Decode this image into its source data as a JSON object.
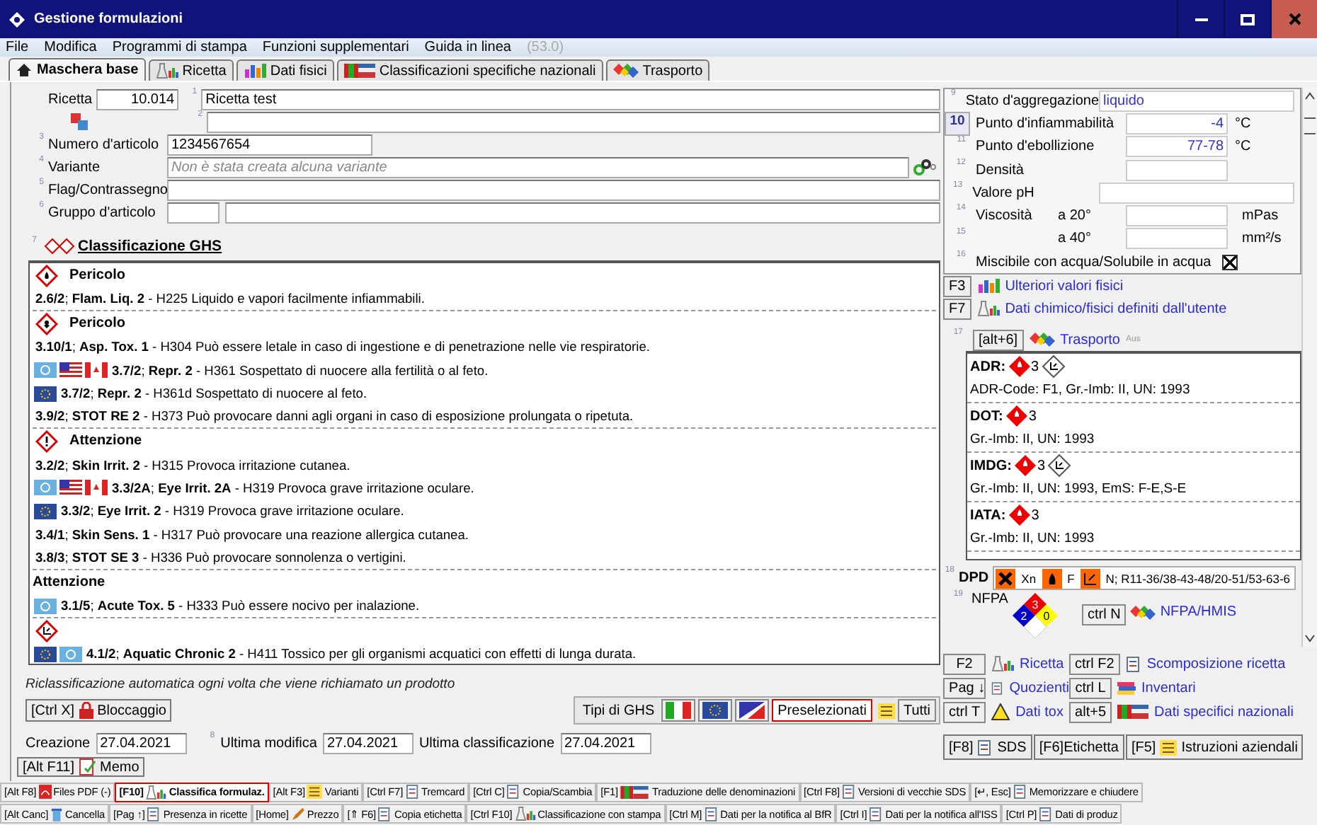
{
  "window": {
    "title": "Gestione formulazioni"
  },
  "menu": {
    "items": [
      "File",
      "Modifica",
      "Programmi di stampa",
      "Funzioni supplementari",
      "Guida in linea"
    ],
    "version": "(53.0)"
  },
  "tabs": [
    {
      "label": "Maschera base",
      "selected": true
    },
    {
      "label": "Ricetta",
      "selected": false
    },
    {
      "label": "Dati fisici",
      "selected": false
    },
    {
      "label": "Classificazioni specifiche nazionali",
      "selected": false
    },
    {
      "label": "Trasporto",
      "selected": false
    }
  ],
  "recipe": {
    "label": "Ricetta",
    "number": "10.014",
    "fields": [
      {
        "index": "1",
        "value": "Ricetta test"
      },
      {
        "index": "2"
      }
    ]
  },
  "form_fields": [
    {
      "index": "3",
      "label": "Numero d'articolo",
      "value": "1234567654",
      "kind": "short"
    },
    {
      "index": "4",
      "label": "Variante",
      "placeholder": "Non è stata creata alcuna variante",
      "kind": "variant"
    },
    {
      "index": "5",
      "label": "Flag/Contrassegno",
      "kind": "wide"
    },
    {
      "index": "6",
      "label": "Gruppo d'articolo",
      "kind": "group"
    }
  ],
  "ghs": {
    "index": "7",
    "title": "Classificazione GHS",
    "groups": [
      {
        "pictogram": {
          "kind": "flame"
        },
        "signal_word": "Pericolo",
        "entries": [
          {
            "text": "**2.6/2**; **Flam. Liq. 2** - H225 Liquido e vapori facilmente infiammabili."
          }
        ]
      },
      {
        "pictogram": {
          "kind": "health"
        },
        "signal_word": "Pericolo",
        "entries": [
          {
            "text": "**3.10/1**; **Asp. Tox. 1** - H304 Può essere letale in caso di ingestione e di penetrazione nelle vie respiratorie."
          },
          {
            "flags": [
              {
                "kind": "un"
              },
              {
                "kind": "us"
              },
              {
                "kind": "ca"
              }
            ],
            "text": "**3.7/2**; **Repr. 2** - H361 Sospettato di nuocere alla fertilità o al feto."
          },
          {
            "flags": [
              {
                "kind": "eu"
              }
            ],
            "text": "**3.7/2**; **Repr. 2** - H361d Sospettato di nuocere al feto."
          },
          {
            "text": "**3.9/2**; **STOT RE 2** - H373 Può provocare danni agli organi in caso di esposizione prolungata o ripetuta."
          }
        ]
      },
      {
        "pictogram": {
          "kind": "exclamation"
        },
        "signal_word": "Attenzione",
        "entries": [
          {
            "text": "**3.2/2**; **Skin Irrit. 2** - H315 Provoca irritazione cutanea."
          },
          {
            "flags": [
              {
                "kind": "un"
              },
              {
                "kind": "us"
              },
              {
                "kind": "ca"
              }
            ],
            "text": "**3.3/2A**; **Eye Irrit. 2A** - H319 Provoca grave irritazione oculare."
          },
          {
            "flags": [
              {
                "kind": "eu"
              }
            ],
            "text": "**3.3/2**; **Eye Irrit. 2** - H319 Provoca grave irritazione oculare."
          },
          {
            "text": "**3.4/1**; **Skin Sens. 1** - H317 Può provocare una reazione allergica cutanea."
          },
          {
            "text": "**3.8/3**; **STOT SE 3** - H336 Può provocare sonnolenza o vertigini."
          }
        ]
      },
      {
        "signal_word": "Attenzione",
        "entries": [
          {
            "flags": [
              {
                "kind": "un"
              }
            ],
            "text": "**3.1/5**; **Acute Tox. 5** - H333 Può essere nocivo per inalazione."
          }
        ]
      },
      {
        "pictogram": {
          "kind": "environment"
        },
        "entries": [
          {
            "flags": [
              {
                "kind": "eu"
              },
              {
                "kind": "un"
              }
            ],
            "text": "**4.1/2**; **Aquatic Chronic 2** - H411 Tossico per gli organismi acquatici con effetti di lunga durata."
          }
        ]
      }
    ]
  },
  "note": "Riclassificazione automatica ogni volta che viene richiamato un prodotto",
  "lock_button": {
    "key": "[Ctrl X]",
    "label": "Bloccaggio"
  },
  "ghs_types": {
    "label": "Tipi di GHS",
    "options": [
      {
        "kind": "flag-it",
        "selected": false
      },
      {
        "kind": "flag-eu",
        "selected": false
      },
      {
        "kind": "flag-us-ca",
        "selected": false
      },
      {
        "kind": "text",
        "text": "Preselezionati",
        "selected": true
      },
      {
        "kind": "list",
        "text": "Tutti",
        "selected": false
      }
    ]
  },
  "dates": [
    {
      "label": "Creazione",
      "value": "27.04.2021"
    },
    {
      "index": "8",
      "label": "Ultima modifica",
      "value": "27.04.2021"
    },
    {
      "label": "Ultima classificazione",
      "value": "27.04.2021"
    }
  ],
  "memo_button": {
    "key": "[Alt F11]",
    "label": "Memo"
  },
  "properties": [
    {
      "index": "9",
      "label": "Stato d'aggregazione",
      "value": "liquido",
      "kind": "wide",
      "highlighted": false
    },
    {
      "index": "10",
      "label": "Punto d'infiammabilità",
      "value": "-4",
      "unit": "°C",
      "kind": "numeric",
      "highlighted": true
    },
    {
      "index": "11",
      "label": "Punto d'ebollizione",
      "value": "77-78",
      "unit": "°C",
      "kind": "numeric",
      "highlighted": false
    },
    {
      "index": "12",
      "label": "Densità",
      "kind": "numeric",
      "highlighted": false
    },
    {
      "index": "13",
      "label": "Valore pH",
      "kind": "wide",
      "highlighted": false
    },
    {
      "index": "14",
      "label": "Viscosità",
      "sublabel": "a 20°",
      "unit": "mPas",
      "kind": "viscosity",
      "highlighted": false
    },
    {
      "index": "15",
      "sublabel": "a 40°",
      "unit": "mm²/s",
      "kind": "viscosity",
      "highlighted": false
    },
    {
      "index": "16",
      "label": "Miscibile con acqua/Solubile in acqua",
      "kind": "checkbox",
      "checked": true,
      "highlighted": false
    }
  ],
  "physical_links": [
    {
      "key": "F3",
      "label": "Ulteriori valori fisici"
    },
    {
      "key": "F7",
      "label": "Dati chimico/fisici definiti dall'utente"
    }
  ],
  "transport": {
    "index": "17",
    "key": "[alt+6]",
    "label": "Trasporto",
    "note": "Aus",
    "items": [
      {
        "mode": "ADR:",
        "class": "3",
        "environment": true,
        "details": "ADR-Code: F1, Gr.-Imb: II, UN: 1993"
      },
      {
        "mode": "DOT:",
        "class": "3",
        "environment": false,
        "details": "Gr.-Imb: II, UN: 1993"
      },
      {
        "mode": "IMDG:",
        "class": "3",
        "environment": true,
        "details": "Gr.-Imb: II, UN: 1993, EmS: F-E,S-E"
      },
      {
        "mode": "IATA:",
        "class": "3",
        "environment": false,
        "details": "Gr.-Imb: II, UN: 1993"
      }
    ]
  },
  "dpd": {
    "index": "18",
    "label": "DPD",
    "symbols": [
      {
        "kind": "cross",
        "text": "Xn"
      },
      {
        "kind": "flame",
        "text": "F"
      },
      {
        "kind": "environment",
        "text": "N; R11-36/38-43-48/20-51/53-63-6"
      }
    ]
  },
  "nfpa": {
    "index": "19",
    "label": "NFPA",
    "flammability": "3",
    "health": "2",
    "instability": "0",
    "key": "ctrl N",
    "link": "NFPA/HMIS"
  },
  "links": [
    {
      "key": "F2",
      "label": "Ricetta"
    },
    {
      "key": "ctrl F2",
      "label": "Scomposizione ricetta"
    },
    {
      "key": "Pag ↓",
      "label": "Quozienti"
    },
    {
      "key": "ctrl L",
      "label": "Inventari"
    },
    {
      "key": "ctrl T",
      "label": "Dati tox"
    },
    {
      "key": "alt+5",
      "label": "Dati specifici nazionali"
    }
  ],
  "doc_buttons": [
    {
      "key": "[F8]",
      "label": "SDS"
    },
    {
      "key": "[F6]",
      "label": "Etichetta"
    },
    {
      "key": "[F5]",
      "label": "Istruzioni aziendali"
    }
  ],
  "toolbars": [
    [
      {
        "key": "[Alt F8]",
        "label": "Files PDF (-)",
        "selected": false
      },
      {
        "key": "[F10]",
        "label": "Classifica formulaz.",
        "selected": true
      },
      {
        "key": "[Alt F3]",
        "label": "Varianti",
        "selected": false
      },
      {
        "key": "[Ctrl F7]",
        "label": "Tremcard",
        "selected": false
      },
      {
        "key": "[Ctrl C]",
        "label": "Copia/Scambia",
        "selected": false
      },
      {
        "key": "[F1]",
        "label": "Traduzione delle denominazioni",
        "selected": false
      },
      {
        "key": "[Ctrl F8]",
        "label": "Versioni di vecchie SDS",
        "selected": false
      },
      {
        "key": "[↵, Esc]",
        "label": "Memorizzare e chiudere",
        "selected": false
      }
    ],
    [
      {
        "key": "[Alt Canc]",
        "label": "Cancella",
        "selected": false
      },
      {
        "key": "[Pag ↑]",
        "label": "Presenza in ricette",
        "selected": false
      },
      {
        "key": "[Home]",
        "label": "Prezzo",
        "selected": false
      },
      {
        "key": "[⇑ F6]",
        "label": "Copia etichetta",
        "selected": false
      },
      {
        "key": "[Ctrl F10]",
        "label": "Classificazione con stampa",
        "selected": false
      },
      {
        "key": "[Ctrl M]",
        "label": "Dati per la notifica al BfR",
        "selected": false
      },
      {
        "key": "[Ctrl I]",
        "label": "Dati per la notifica all'ISS",
        "selected": false
      },
      {
        "key": "[Ctrl P]",
        "label": "Dati di produz",
        "selected": false
      }
    ]
  ]
}
